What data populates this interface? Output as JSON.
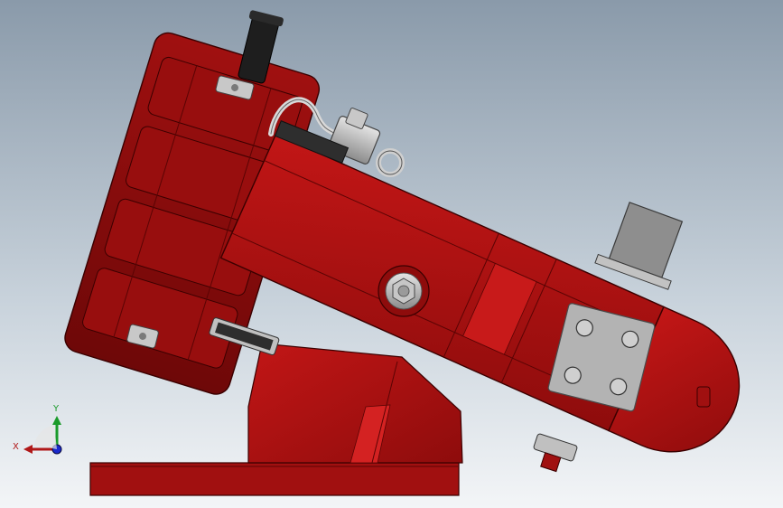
{
  "viewport": {
    "background_top": "#8a9aaa",
    "background_bottom": "#f3f5f7"
  },
  "model": {
    "body_color": "#b01212",
    "body_dark": "#7d0a0a",
    "hardware_color": "#b8b8b8"
  },
  "triad": {
    "x_label": "X",
    "y_label": "Y",
    "x_color": "#b01818",
    "y_color": "#1a9a2a",
    "z_color": "#1a2acc"
  }
}
